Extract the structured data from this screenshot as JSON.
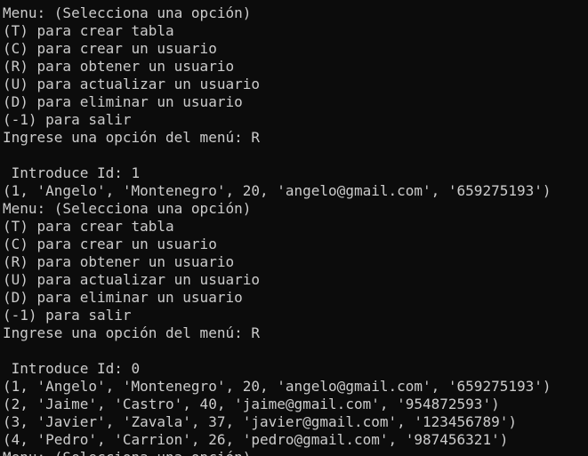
{
  "terminal": {
    "lines": [
      "Menu: (Selecciona una opción)",
      "(T) para crear tabla",
      "(C) para crear un usuario",
      "(R) para obtener un usuario",
      "(U) para actualizar un usuario",
      "(D) para eliminar un usuario",
      "(-1) para salir",
      "Ingrese una opción del menú: R",
      "",
      " Introduce Id: 1",
      "(1, 'Angelo', 'Montenegro', 20, 'angelo@gmail.com', '659275193')",
      "Menu: (Selecciona una opción)",
      "(T) para crear tabla",
      "(C) para crear un usuario",
      "(R) para obtener un usuario",
      "(U) para actualizar un usuario",
      "(D) para eliminar un usuario",
      "(-1) para salir",
      "Ingrese una opción del menú: R",
      "",
      " Introduce Id: 0",
      "(1, 'Angelo', 'Montenegro', 20, 'angelo@gmail.com', '659275193')",
      "(2, 'Jaime', 'Castro', 40, 'jaime@gmail.com', '954872593')",
      "(3, 'Javier', 'Zavala', 37, 'javier@gmail.com', '123456789')",
      "(4, 'Pedro', 'Carrion', 26, 'pedro@gmail.com', '987456321')",
      "Menu: (Selecciona una opción)"
    ]
  }
}
